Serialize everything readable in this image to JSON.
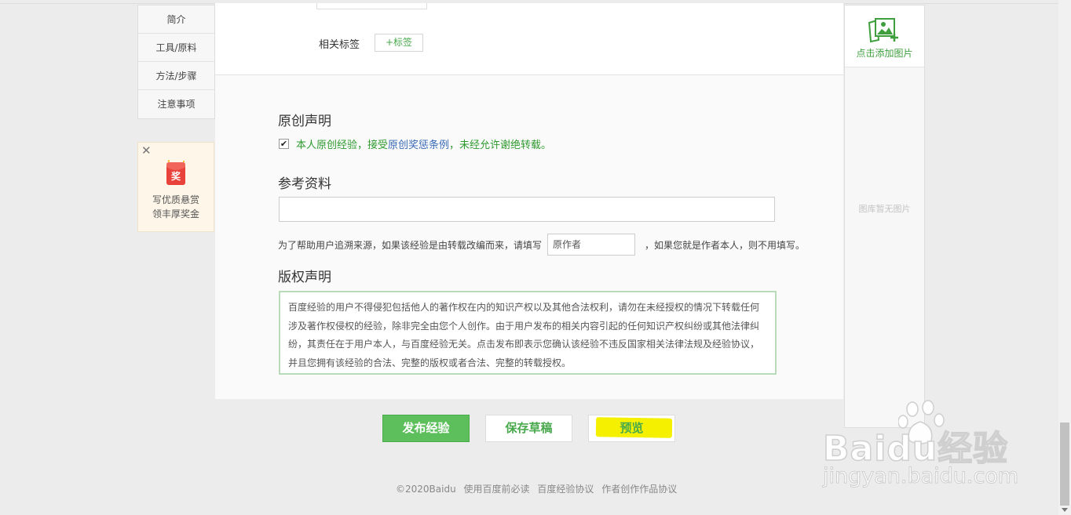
{
  "side_nav": {
    "items": [
      {
        "label": "简介"
      },
      {
        "label": "工具/原料"
      },
      {
        "label": "方法/步骤"
      },
      {
        "label": "注意事项"
      }
    ]
  },
  "promo": {
    "badge": "奖",
    "line1": "写优质悬赏",
    "line2": "领丰厚奖金"
  },
  "tags": {
    "label": "相关标签",
    "add_button": "+标签"
  },
  "original": {
    "title": "原创声明",
    "checked": true,
    "text_before": "本人原创经验，接受",
    "link": "原创奖惩条例",
    "text_after": "，未经允许谢绝转载。"
  },
  "reference": {
    "title": "参考资料",
    "textarea_value": "",
    "hint_before": "为了帮助用户追溯来源，如果该经验是由转载改编而来，请填写",
    "author_placeholder": "原作者",
    "hint_after": "，如果您就是作者本人，则不用填写。"
  },
  "copyright": {
    "title": "版权声明",
    "text": "百度经验的用户不得侵犯包括他人的著作权在内的知识产权以及其他合法权利，请勿在未经授权的情况下转载任何涉及著作权侵权的经验，除非完全由您个人创作。由于用户发布的相关内容引起的任何知识产权纠纷或其他法律纠纷，其责任在于用户本人，与百度经验无关。点击发布即表示您确认该经验不违反国家相关法律法规及经验协议，并且您拥有该经验的合法、完整的版权或者合法、完整的转载授权。"
  },
  "image_panel": {
    "add_label": "点击添加图片",
    "empty_text": "图库暂无图片"
  },
  "actions": {
    "publish": "发布经验",
    "save_draft": "保存草稿",
    "preview": "预览"
  },
  "footer": {
    "copyright": "©2020Baidu",
    "links": [
      "使用百度前必读",
      "百度经验协议",
      "作者创作作品协议"
    ]
  },
  "watermark": {
    "brand": "Baidu经验",
    "url": "jingyan.baidu.com"
  },
  "colors": {
    "accent_green": "#5cbf5c",
    "link_blue": "#3a6bb6",
    "highlight_yellow": "#f4f000"
  }
}
